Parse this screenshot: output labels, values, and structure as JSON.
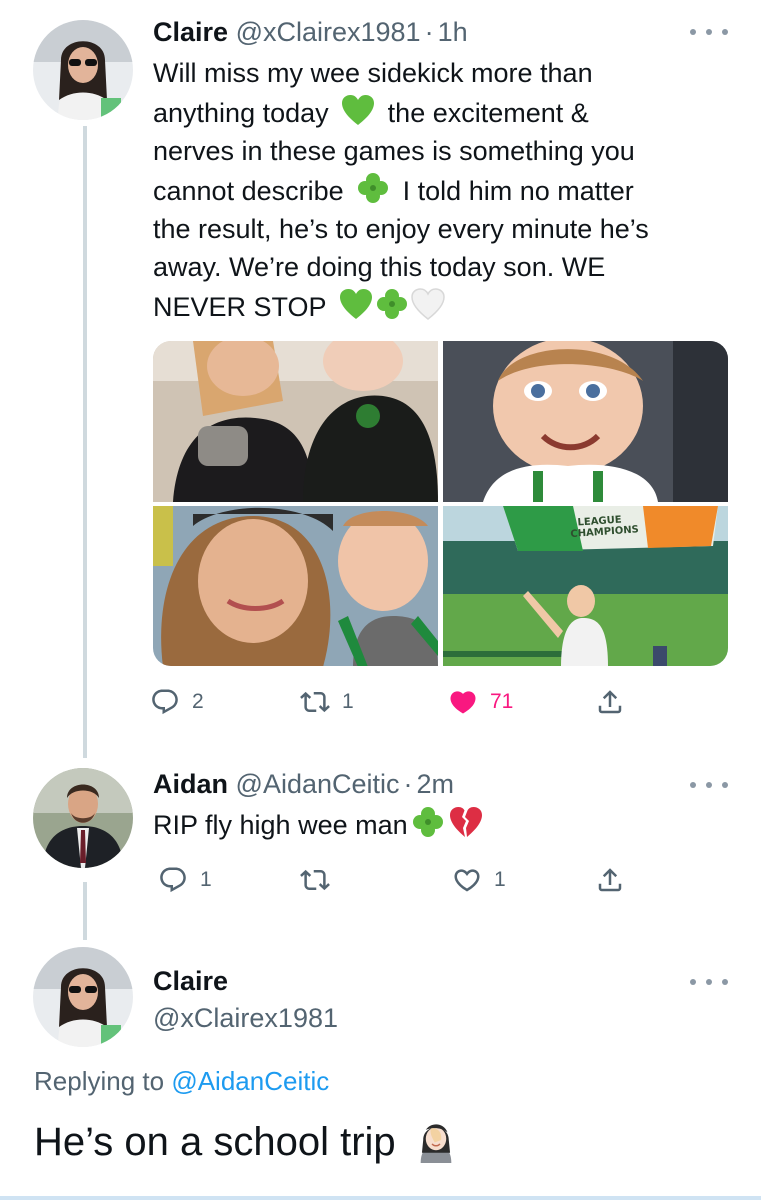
{
  "tweet1": {
    "name": "Claire",
    "handle": "@xClairex1981",
    "separator": "·",
    "time": "1h",
    "text_line1": "Will miss my wee sidekick more than",
    "text_line2a": "anything today",
    "text_line2b": "the excitement &",
    "text_line3": "nerves in these games is something you",
    "text_line4a": "cannot describe",
    "text_line4b": "I told him no matter",
    "text_line5": "the result, he’s to enjoy every minute he’s",
    "text_line6": "away. We’re doing this today son. WE",
    "text_line7": "NEVER STOP",
    "photo_banner_text": "LEAGUE CHAMPIONS",
    "reply_count": "2",
    "retweet_count": "1",
    "like_count": "71"
  },
  "tweet2": {
    "name": "Aidan",
    "handle": "@AidanCeitic",
    "separator": "·",
    "time": "2m",
    "text": "RIP fly high wee man",
    "reply_count": "1",
    "retweet_count": "",
    "like_count": "1"
  },
  "tweet3": {
    "name": "Claire",
    "handle": "@xClairex1981",
    "replying_prefix": "Replying to",
    "replying_to": "@AidanCeitic",
    "text": "He’s on a school trip"
  },
  "colors": {
    "text": "#0f1419",
    "secondary": "#536471",
    "link": "#1d9bf0",
    "like_active": "#f91880",
    "thread_line": "#cfd9de"
  },
  "icons": [
    "more-icon",
    "reply-icon",
    "retweet-icon",
    "like-icon",
    "share-icon",
    "green-heart-emoji",
    "shamrock-emoji",
    "white-heart-emoji",
    "broken-heart-emoji",
    "facepalm-emoji"
  ]
}
